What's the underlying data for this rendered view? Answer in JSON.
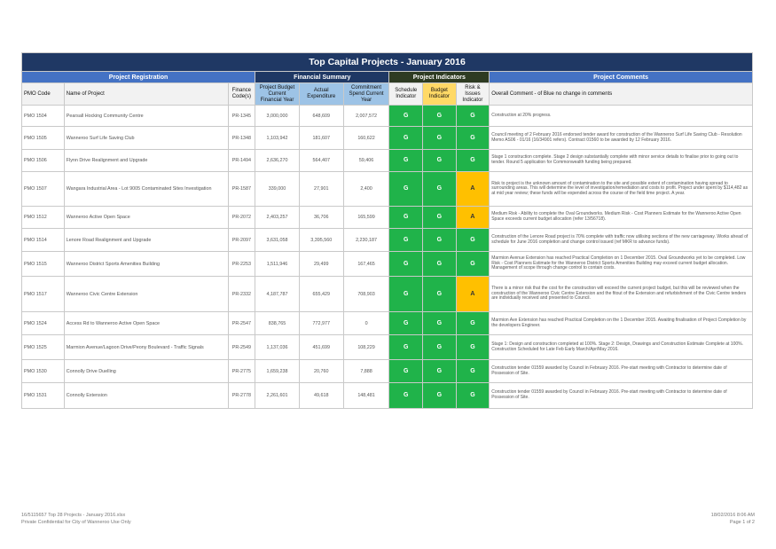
{
  "title": "Top Capital Projects - January 2016",
  "groups": {
    "registration": "Project Registration",
    "financial": "Financial Summary",
    "indicators": "Project Indicators",
    "comments": "Project Comments"
  },
  "headers": {
    "pmo_code": "PMO Code",
    "name": "Name of Project",
    "finance_code": "Finance Code(s)",
    "budget": "Project Budget Current Financial Year",
    "actual": "Actual Expenditure",
    "commitment": "Commitment Spend Current Year",
    "schedule": "Schedule Indicator",
    "budget_ind": "Budget Indicator",
    "risk": "Risk & Issues Indicator",
    "comment": "Overall Comment - of Blue no change in comments"
  },
  "colors": {
    "green": "#20b34a",
    "amber": "#ffc000",
    "navy": "#1f3864",
    "blue": "#4472c4"
  },
  "rows": [
    {
      "pmo": "PMO 1504",
      "name": "Pearsall Hocking Community Centre",
      "code": "PR-1345",
      "budget": "3,000,000",
      "actual": "648,609",
      "commit": "2,007,572",
      "s": "G",
      "b": "G",
      "r": "G",
      "comment": "Construction at 20% progress."
    },
    {
      "pmo": "PMO 1505",
      "name": "Wanneroo Surf Life Saving Club",
      "code": "PR-1348",
      "budget": "1,103,942",
      "actual": "181,607",
      "commit": "160,622",
      "s": "G",
      "b": "G",
      "r": "G",
      "comment": "Council meeting of 2 February 2016 endorsed tender award for construction of the Wanneroo Surf Life Saving Club - Resolution Memo AS06 - 01/16 (16/34901 refers). Contract 01560 to be awarded by 12 February 2016."
    },
    {
      "pmo": "PMO 1506",
      "name": "Flynn Drive Realignment and Upgrade",
      "code": "PR-1494",
      "budget": "2,636,270",
      "actual": "564,407",
      "commit": "59,406",
      "s": "G",
      "b": "G",
      "r": "G",
      "comment": "Stage 1 construction complete. Stage 2 design substantially complete with minor service details to finalise prior to going out to tender. Round 5 application for Commonwealth funding being prepared."
    },
    {
      "pmo": "PMO 1507",
      "name": "Wangara Industrial Area - Lot 9005 Contaminated Sites Investigation",
      "code": "PR-1587",
      "budget": "339,000",
      "actual": "27,901",
      "commit": "2,400",
      "s": "G",
      "b": "G",
      "r": "A",
      "comment": "Risk to project is the unknown amount of contamination to the site and possible extent of contamination having spread to surrounding areas. This will determine the level of investigation/remediation and costs to profit. Project under spent by $114,482 as at mid year review; these funds will be expended across the course of the field time project. A year."
    },
    {
      "pmo": "PMO 1512",
      "name": "Wanneroo Active Open Space",
      "code": "PR-2072",
      "budget": "2,403,257",
      "actual": "36,706",
      "commit": "165,599",
      "s": "G",
      "b": "G",
      "r": "A",
      "comment": "Medium Risk - Ability to complete the Oval Groundworks. Medium Risk - Cost Planners Estimate for the Wanneroo Active Open Space exceeds current budget allocation (refer 13/56718)."
    },
    {
      "pmo": "PMO 1514",
      "name": "Lenore Road Realignment and Upgrade",
      "code": "PR-2097",
      "budget": "3,631,058",
      "actual": "3,395,560",
      "commit": "2,230,187",
      "s": "G",
      "b": "G",
      "r": "G",
      "comment": "Construction of the Lenore Road project is 70% complete with traffic now utilising sections of the new carriageway. Works ahead of schedule for June 2016 completion and change control issued (ref MKR to advance funds)."
    },
    {
      "pmo": "PMO 1515",
      "name": "Wanneroo District Sports Amenities Building",
      "code": "PR-2253",
      "budget": "1,511,946",
      "actual": "29,499",
      "commit": "167,465",
      "s": "G",
      "b": "G",
      "r": "G",
      "comment": "Marmion Avenue Extension has reached Practical Completion on 1 December 2015. Oval Groundworks yet to be completed. Low Risk - Cost Planners Estimate for the Wanneroo District Sports Amenities Building may exceed current budget allocation. Management of scope through change control to contain costs."
    },
    {
      "pmo": "PMO 1517",
      "name": "Wanneroo Civic Centre Extension",
      "code": "PR-2332",
      "budget": "4,187,787",
      "actual": "655,429",
      "commit": "708,903",
      "s": "G",
      "b": "G",
      "r": "A",
      "comment": "There is a minor risk that the cost for the construction will exceed the current project budget, but this will be reviewed when the construction of the Wanneroo Civic Centre Extension and the fitout of the Extension and refurbishment of the Civic Centre tenders are individually received and presented to Council."
    },
    {
      "pmo": "PMO 1524",
      "name": "Access Rd to Wanneroo Active Open Space",
      "code": "PR-2547",
      "budget": "838,765",
      "actual": "772,977",
      "commit": "0",
      "s": "G",
      "b": "G",
      "r": "G",
      "comment": "Marmion Ave Extension has reached Practical Completion on the 1 December 2015. Awaiting finalisation of Project Completion by the developers Engineer."
    },
    {
      "pmo": "PMO 1525",
      "name": "Marmion Avenue/Lagoon Drive/Peony Boulevard - Traffic Signals",
      "code": "PR-2549",
      "budget": "1,137,036",
      "actual": "451,699",
      "commit": "108,229",
      "s": "G",
      "b": "G",
      "r": "G",
      "comment": "Stage 1: Design and construction completed at 100%. Stage 2: Design, Drawings and Construction Estimate Complete at 100%. Construction Scheduled for Late Feb Early March/Apr/May 2016."
    },
    {
      "pmo": "PMO 1530",
      "name": "Connolly Drive Duelling",
      "code": "PR-2775",
      "budget": "1,659,238",
      "actual": "20,760",
      "commit": "7,888",
      "s": "G",
      "b": "G",
      "r": "G",
      "comment": "Construction tender 01559 awarded by Council in February 2016. Pre-start meeting with Contractor to determine date of Possession of Site."
    },
    {
      "pmo": "PMO 1531",
      "name": "Connolly Extension",
      "code": "PR-2778",
      "budget": "2,261,601",
      "actual": "49,618",
      "commit": "148,481",
      "s": "G",
      "b": "G",
      "r": "G",
      "comment": "Construction tender 01559 awarded by Council in February 2016. Pre-start meeting with Contractor to determine date of Possession of Site."
    }
  ],
  "footer": {
    "file": "16/5115657 Top 28 Projects - January 2016.xlsx",
    "confidential": "Private Confidential for City of Wanneroo Use Only",
    "date": "18/02/2016 8:06 AM",
    "page": "Page 1 of 2"
  }
}
